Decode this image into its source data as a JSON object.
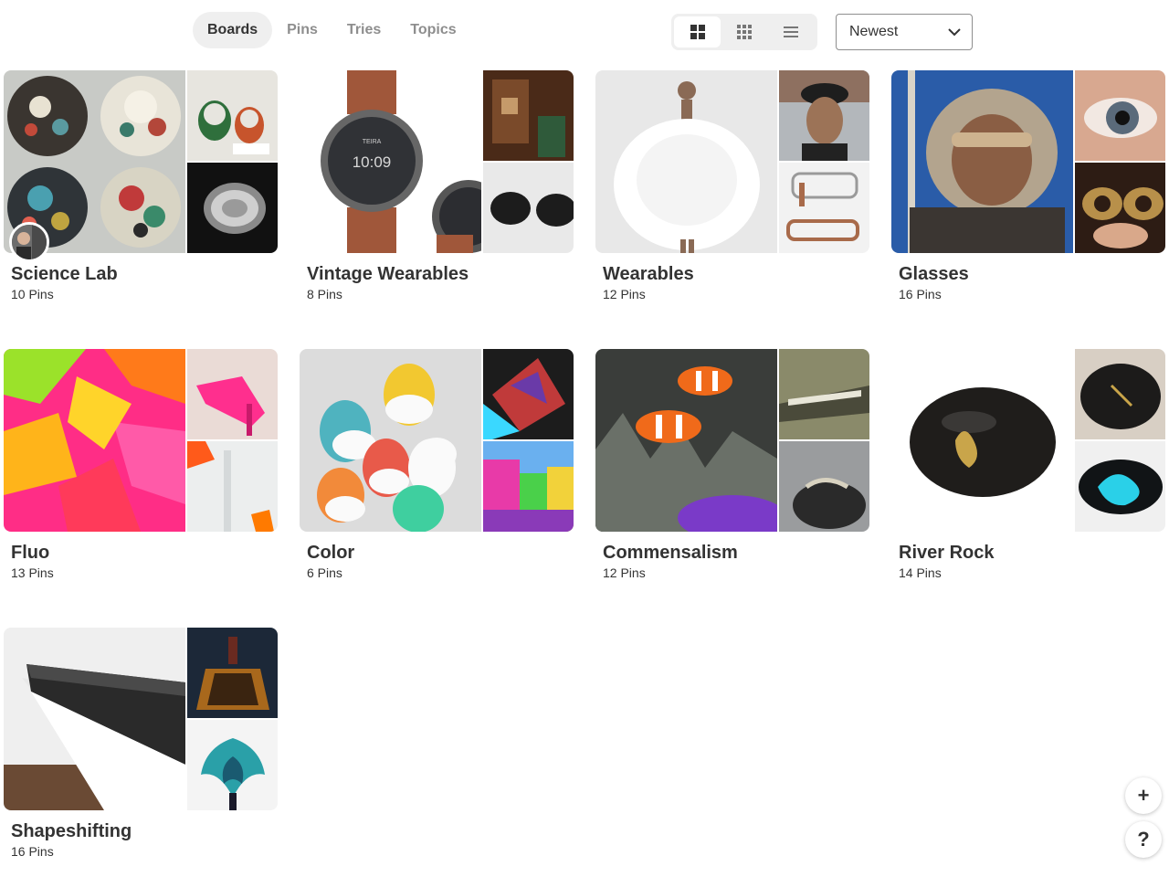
{
  "tabs": [
    {
      "label": "Boards",
      "active": true
    },
    {
      "label": "Pins",
      "active": false
    },
    {
      "label": "Tries",
      "active": false
    },
    {
      "label": "Topics",
      "active": false
    }
  ],
  "view_toggle": [
    {
      "icon": "large-grid-icon",
      "active": true
    },
    {
      "icon": "compact-grid-icon",
      "active": false
    },
    {
      "icon": "list-icon",
      "active": false
    }
  ],
  "sort": {
    "selected": "Newest",
    "icon": "chevron-down-icon"
  },
  "boards": [
    {
      "title": "Science Lab",
      "count": "10 Pins"
    },
    {
      "title": "Vintage Wearables",
      "count": "8 Pins"
    },
    {
      "title": "Wearables",
      "count": "12 Pins"
    },
    {
      "title": "Glasses",
      "count": "16 Pins"
    },
    {
      "title": "Fluo",
      "count": "13 Pins"
    },
    {
      "title": "Color",
      "count": "6 Pins"
    },
    {
      "title": "Commensalism",
      "count": "12 Pins"
    },
    {
      "title": "River Rock",
      "count": "14 Pins"
    },
    {
      "title": "Shapeshifting",
      "count": "16 Pins"
    }
  ],
  "watch_face": {
    "brand": "TEIRA",
    "time": "10:09"
  },
  "fab": {
    "add": "+",
    "help": "?"
  },
  "colors": {
    "active_tab_bg": "#efefef",
    "text": "#333333",
    "muted": "#8e8e8e"
  }
}
